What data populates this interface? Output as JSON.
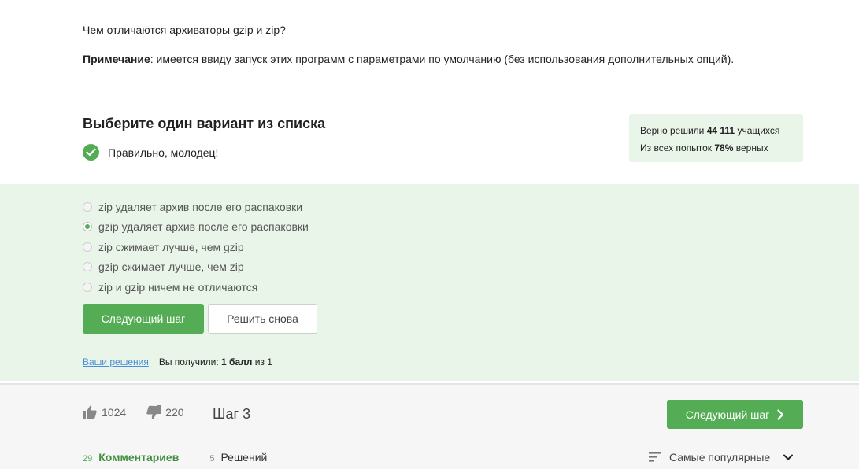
{
  "question": {
    "text": "Чем отличаются архиваторы gzip и zip?",
    "note_label": "Примечание",
    "note_text": ": имеется ввиду запуск этих программ с параметрами по умолчанию (без использования дополнительных опций)."
  },
  "task": {
    "title": "Выберите один вариант из списка",
    "feedback": "Правильно, молодец!"
  },
  "stats": {
    "solved_prefix": "Верно решили",
    "solved_count": "44 111",
    "solved_suffix": "учащихся",
    "attempts_prefix": "Из всех попыток",
    "attempts_percent": "78%",
    "attempts_suffix": "верных"
  },
  "options": [
    {
      "label": "zip удаляет архив после его распаковки",
      "checked": false
    },
    {
      "label": "gzip удаляет архив после его распаковки",
      "checked": true
    },
    {
      "label": "zip сжимает лучше, чем gzip",
      "checked": false
    },
    {
      "label": "gzip сжимает лучше, чем zip",
      "checked": false
    },
    {
      "label": "zip и gzip ничем не отличаются",
      "checked": false
    }
  ],
  "actions": {
    "next_label": "Следующий шаг",
    "retry_label": "Решить снова",
    "your_solutions": "Ваши решения",
    "score_prefix": "Вы получили:",
    "score_value": "1 балл",
    "score_suffix": "из 1"
  },
  "bottom": {
    "likes": "1024",
    "dislikes": "220",
    "step": "Шаг 3",
    "next_step_label": "Следующий шаг",
    "comments_count": "29",
    "comments_label": "Комментариев",
    "solutions_count": "5",
    "solutions_label": "Решений",
    "sort_label": "Самые популярные"
  },
  "colors": {
    "accent": "#54ad54",
    "panel": "#e9f5e9",
    "link": "#4b8ed8"
  }
}
